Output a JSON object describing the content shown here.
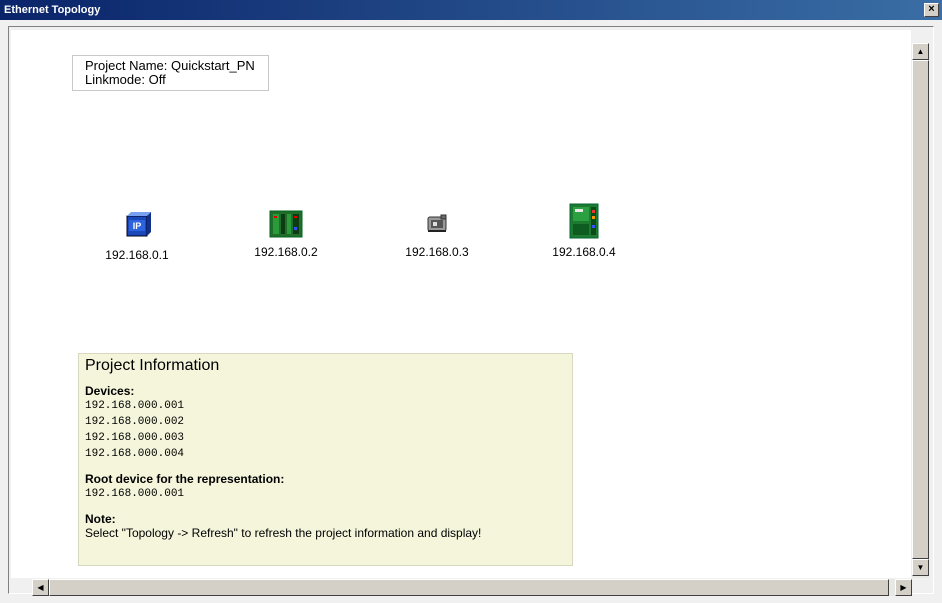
{
  "window": {
    "title": "Ethernet Topology",
    "close_label": "×"
  },
  "project": {
    "name_line": "Project Name: Quickstart_PN",
    "linkmode_line": "Linkmode: Off"
  },
  "devices": [
    {
      "ip": "192.168.0.1",
      "icon": "ip-device-icon"
    },
    {
      "ip": "192.168.0.2",
      "icon": "io-module-icon"
    },
    {
      "ip": "192.168.0.3",
      "icon": "drive-icon"
    },
    {
      "ip": "192.168.0.4",
      "icon": "controller-icon"
    }
  ],
  "info": {
    "title": "Project Information",
    "devices_heading": "Devices:",
    "device_list": [
      "192.168.000.001",
      "192.168.000.002",
      "192.168.000.003",
      "192.168.000.004"
    ],
    "root_heading": "Root device for the representation:",
    "root_value": "192.168.000.001",
    "note_heading": "Note:",
    "note_text": "Select \"Topology -> Refresh\" to refresh the project information and display!"
  },
  "scrollbar": {
    "up": "▲",
    "down": "▼",
    "left": "◀",
    "right": "▶"
  }
}
